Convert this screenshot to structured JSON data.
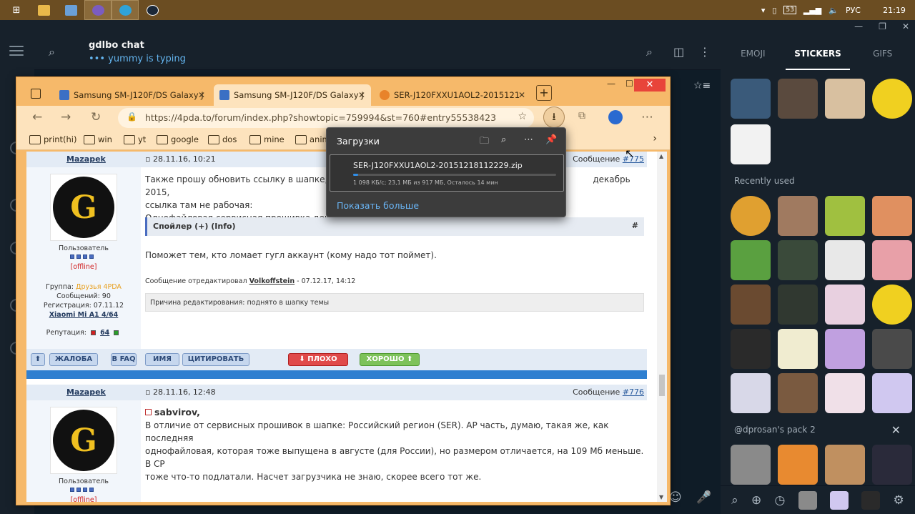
{
  "taskbar": {
    "time": "21:19",
    "lang": "РУС",
    "battery": "53"
  },
  "telegram": {
    "chat_title": "gdlbo chat",
    "typing": "••• yummy is typing"
  },
  "stickers": {
    "tabs": [
      "EMOJI",
      "STICKERS",
      "GIFS"
    ],
    "recent_label": "Recently used",
    "pack_label": "@dprosan's pack 2"
  },
  "browser": {
    "tabs": [
      {
        "label": "Samsung SM-J120F/DS Galaxy J",
        "color": "#3b6fc4"
      },
      {
        "label": "Samsung SM-J120F/DS Galaxy J",
        "color": "#3b6fc4"
      },
      {
        "label": "SER-J120FXXU1AOL2-2015121",
        "color": "#e8832a"
      }
    ],
    "url": "https://4pda.to/forum/index.php?showtopic=759994&st=760#entry55538423",
    "bookmarks": [
      "print(hi)",
      "win",
      "yt",
      "google",
      "dos",
      "mine",
      "anim"
    ]
  },
  "downloads": {
    "title": "Загрузки",
    "file": "SER-J120FXXU1AOL2-20151218112229.zip",
    "progress": 0.025,
    "status": "1 098 КБ/с; 23,1 МБ из 917 МБ, Осталось 14 мин",
    "more": "Показать больше"
  },
  "forum": {
    "post1": {
      "author": "Mazapek",
      "date": "28.11.16, 10:21",
      "msg_label": "Сообщение ",
      "msg_num": "#775",
      "role": "Пользователь",
      "status": "[offline]",
      "group_label": "Группа: ",
      "group": "Друзья 4PDA",
      "posts": "Сообщений: 90",
      "reg": "Регистрация: 07.11.12",
      "device": "Xiaomi Mi A1 4/64",
      "rep_label": "Репутация:",
      "rep": "64",
      "body_line1": "Также прошу обновить ссылку в шапке, на",
      "body_line1_end": "декабрь 2015,",
      "body_line2": "ссылка там не рабочая:",
      "body_link": "Однофайловая сервисная прошивка декаб",
      "spoiler": "Спойлер (+) (Info)",
      "spoiler_hash": "#",
      "body2": "Поможет тем, кто ломает гугл аккаунт (кому надо тот поймет).",
      "edited_prefix": "Сообщение отредактировал ",
      "edited_by": "Volkoffstein",
      "edited_date": " - 07.12.17, 14:12",
      "reason": "Причина редактирования: поднято в шапку темы"
    },
    "actions": {
      "up": "⬆",
      "complain": "ЖАЛОБА",
      "faq": "В FAQ",
      "name": "ИМЯ",
      "quote": "ЦИТИРОВАТЬ",
      "bad": "⬇ ПЛОХО",
      "good": "ХОРОШО ⬆"
    },
    "post2": {
      "author": "Mazapek",
      "date": "28.11.16, 12:48",
      "msg_label": "Сообщение ",
      "msg_num": "#776",
      "role": "Пользователь",
      "status": "[offline]",
      "reply_to": "sabvirov,",
      "body1": "В отличие от сервисных прошивок в шапке: Российский регион (SER). AP часть, думаю, такая же, как последняя",
      "body2": "однофайловая, которая тоже выпущена в августе (для России), но размером отличается, на 109 Мб меньше. В CP",
      "body3": "тоже что-то подлатали. Насчет загрузчика не знаю, скорее всего тот же."
    }
  }
}
